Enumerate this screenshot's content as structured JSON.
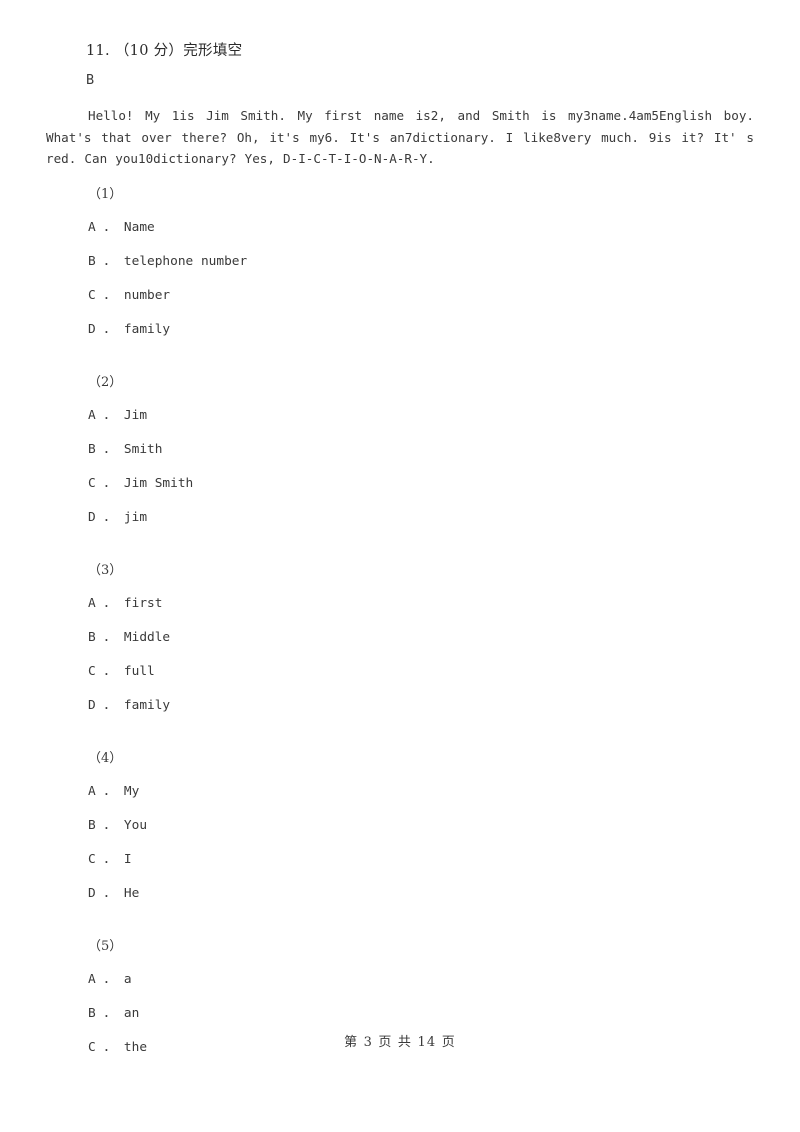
{
  "document": {
    "heading": "11.  （10 分）完形填空",
    "section_label": "B",
    "passage": "Hello! My  1is Jim Smith. My first name is2, and Smith is my3name.4am5English boy. What's that over there? Oh, it's my6. It's an7dictionary. I like8very much. 9is it? It' s red. Can you10dictionary? Yes, D-I-C-T-I-O-N-A-R-Y.",
    "footer": "第 3 页 共 14 页"
  },
  "questions": [
    {
      "number": "（1）",
      "options": [
        "A ． Name",
        "B ． telephone number",
        "C ． number",
        "D ． family"
      ]
    },
    {
      "number": "（2）",
      "options": [
        "A ． Jim",
        "B ． Smith",
        "C ． Jim Smith",
        "D ． jim"
      ]
    },
    {
      "number": "（3）",
      "options": [
        "A ． first",
        "B ． Middle",
        "C ． full",
        "D ． family"
      ]
    },
    {
      "number": "（4）",
      "options": [
        "A ． My",
        "B ． You",
        "C ． I",
        "D ． He"
      ]
    },
    {
      "number": "（5）",
      "options": [
        "A ． a",
        "B ． an",
        "C ． the"
      ]
    }
  ]
}
